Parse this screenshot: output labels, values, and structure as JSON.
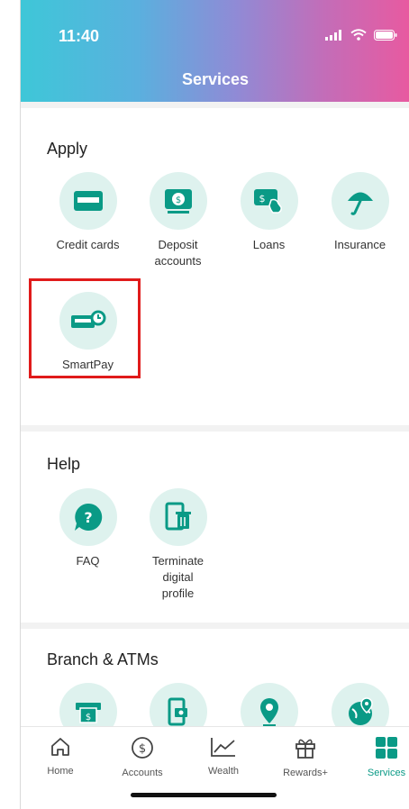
{
  "status": {
    "time": "11:40"
  },
  "header": {
    "title": "Services"
  },
  "apply": {
    "title": "Apply",
    "items": [
      {
        "label": "Credit cards"
      },
      {
        "label": "Deposit\naccounts"
      },
      {
        "label": "Loans"
      },
      {
        "label": "Insurance"
      },
      {
        "label": "SmartPay"
      }
    ]
  },
  "help": {
    "title": "Help",
    "items": [
      {
        "label": "FAQ"
      },
      {
        "label": "Terminate\ndigital\nprofile"
      }
    ]
  },
  "branch": {
    "title": "Branch & ATMs"
  },
  "tabs": [
    {
      "label": "Home"
    },
    {
      "label": "Accounts"
    },
    {
      "label": "Wealth"
    },
    {
      "label": "Rewards+"
    },
    {
      "label": "Services"
    }
  ],
  "colors": {
    "accent": "#0a9a86",
    "icon_bg": "#def2ee",
    "highlight": "#e01b1b"
  }
}
